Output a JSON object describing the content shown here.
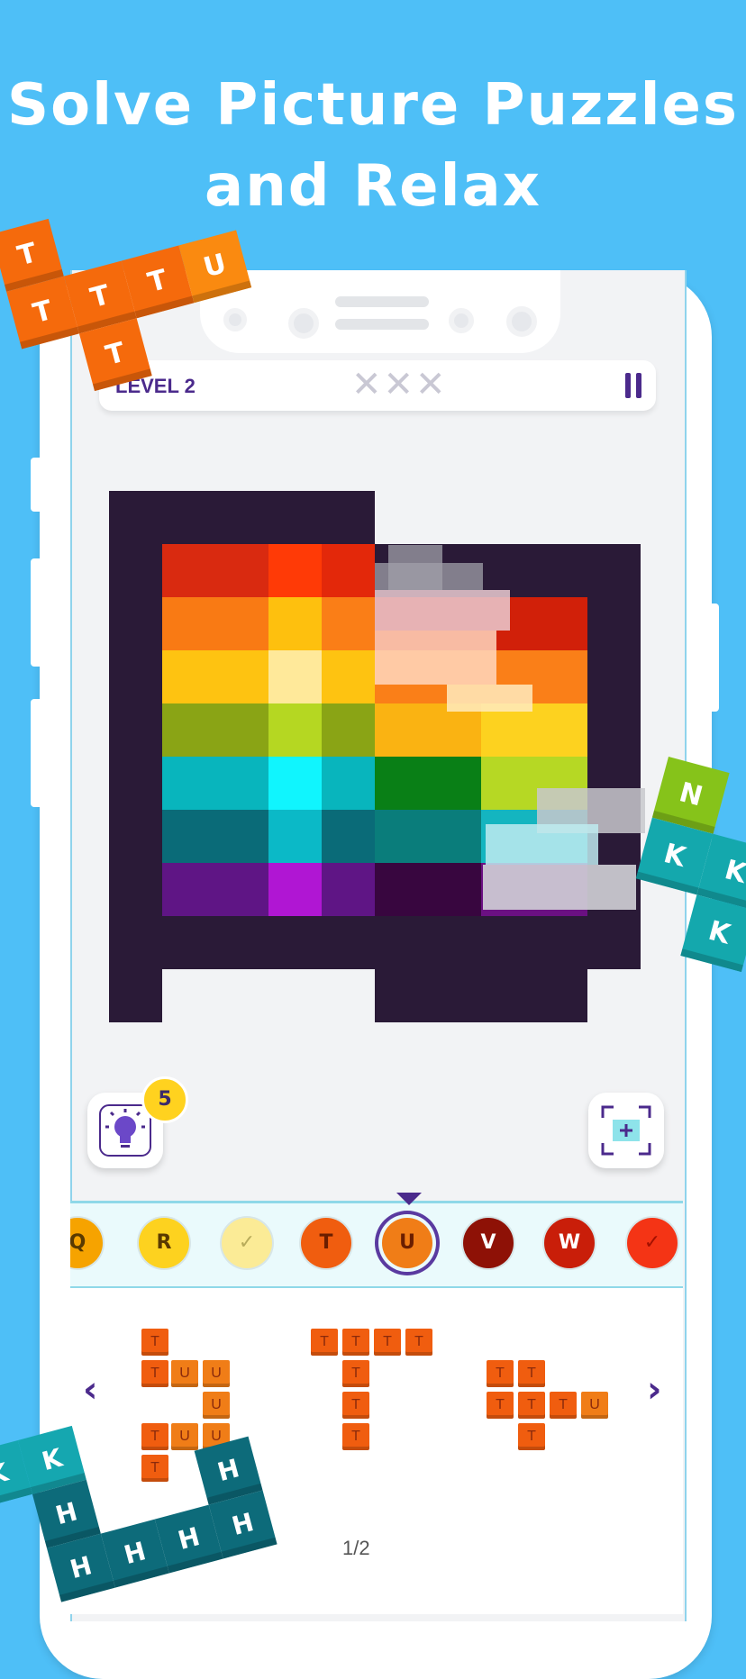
{
  "headline": {
    "line1": "Solve Picture Puzzles",
    "line2": "and Relax"
  },
  "topbar": {
    "level": "LEVEL 2",
    "lives": "✕✕✕"
  },
  "hint": {
    "count": "5"
  },
  "palette": [
    {
      "label": "Q",
      "color": "#f6a300",
      "text": "#5a3a00"
    },
    {
      "label": "R",
      "color": "#fdd21f",
      "text": "#5a3a00"
    },
    {
      "label": "✓",
      "color": "#fbeb96",
      "text": "#b8ab5a"
    },
    {
      "label": "T",
      "color": "#f05d0f",
      "text": "#6a1e00"
    },
    {
      "label": "U",
      "color": "#f07d17",
      "text": "#6a1e00"
    },
    {
      "label": "V",
      "color": "#8e1106",
      "text": "#ffffff"
    },
    {
      "label": "W",
      "color": "#c91e09",
      "text": "#ffffff"
    },
    {
      "label": "✓",
      "color": "#f43415",
      "text": "#a31000"
    }
  ],
  "pager": "1/2",
  "colors": {
    "background": "#4ebff7",
    "accent": "#4b2a8c",
    "dark": "#2a1a37"
  },
  "icons": {
    "hint": "lightbulb-icon",
    "fit": "fit-screen-icon",
    "prev": "chevron-left-icon",
    "next": "chevron-right-icon",
    "pause": "pause-icon"
  },
  "tray_pieces": {
    "piece1": [
      "T",
      "T",
      "U",
      "U",
      "U",
      "T",
      "U",
      "U",
      "T"
    ],
    "piece2": [
      "T",
      "T",
      "T",
      "T",
      "T",
      "T",
      "T"
    ],
    "piece3": [
      "T",
      "T",
      "T",
      "T",
      "T",
      "U",
      "T"
    ]
  },
  "floating": {
    "topleft": [
      "T",
      "T",
      "T",
      "T",
      "U",
      "T"
    ],
    "right": [
      "N",
      "K",
      "K",
      "K"
    ],
    "bottomleft": [
      "K",
      "K",
      "H",
      "H",
      "H",
      "H",
      "H",
      "H"
    ]
  }
}
